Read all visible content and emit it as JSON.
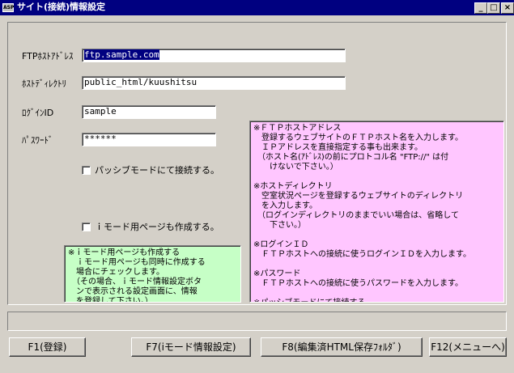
{
  "window": {
    "title": "サイト(接続)情報設定",
    "icon_label": "ASP",
    "minimize": "_",
    "maximize": "□",
    "close": "×"
  },
  "form": {
    "ftp_host_label": "FTPﾎｽﾄｱﾄﾞﾚｽ",
    "ftp_host_value": "ftp.sample.com",
    "host_dir_label": "ﾎｽﾄﾃﾞｨﾚｸﾄﾘ",
    "host_dir_value": "public_html/kuushitsu",
    "login_label": "ﾛｸﾞｲﾝID",
    "login_value": "sample",
    "password_label": "ﾊﾟｽﾜｰﾄﾞ",
    "password_value": "******",
    "passive_label": "パッシブモードにて接続する。",
    "passive_checked": false,
    "imode_label": "ｉモード用ページも作成する。",
    "imode_checked": false
  },
  "help_main": "※ＦＴＰホストアドレス\n　登録するウェブサイトのＦＴＰホスト名を入力します。\n　ＩＰアドレスを直接指定する事も出来ます。\n　（ホスト名(ｱﾄﾞﾚｽ)の前にプロトコル名 \"FTP://\" は付\n　　けないで下さい。）\n\n※ホストディレクトリ\n　空室状況ページを登録するウェブサイトのディレクトリ\n　を入力します。\n　（ログインディレクトリのままでいい場合は、省略して\n　　下さい。）\n\n※ログインＩＤ\n　ＦＴＰホストへの接続に使うログインＩＤを入力します。\n\n※パスワード\n　ＦＴＰホストへの接続に使うパスワードを入力します。\n\n※パッシブモードにて接続する。\n　通常はチェックしませんが、ルータ等を通していて通信\n　出来ない場合にチェックしてみて下さい。",
  "help_imode": "※ｉモード用ページも作成する\n　ｉモード用ページも同時に作成する\n　場合にチェックします。\n　（その場合、ｉモード情報設定ボタ\n　ンで表示される設定画面に、情報\n　を登録して下さい。）",
  "buttons": {
    "f1": "F1(登録)",
    "f7": "F7(iモード情報設定)",
    "f8": "F8(編集済HTML保存ﾌｫﾙﾀﾞ)",
    "f12": "F12(メニューへ)"
  }
}
